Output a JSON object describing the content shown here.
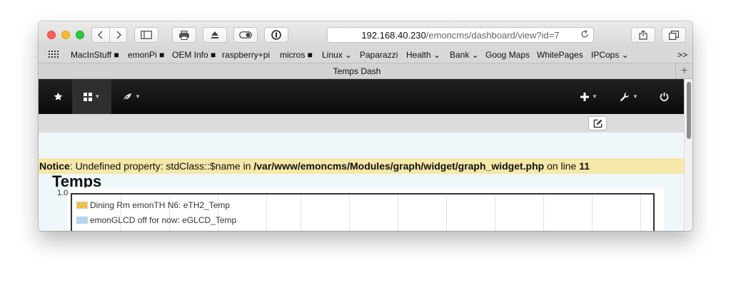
{
  "browser": {
    "url_host": "192.168.40.230",
    "url_path": "/emoncms/dashboard/view?id=7",
    "tab_title": "Temps Dash",
    "overflow_label": ">>",
    "new_tab_label": "+"
  },
  "bookmarks": [
    {
      "label": "MacInStuff ■"
    },
    {
      "label": "emonPi ■"
    },
    {
      "label": "OEM Info ■"
    },
    {
      "label": "raspberry+pi"
    },
    {
      "label": "micros ■"
    },
    {
      "label": "Linux ⌄"
    },
    {
      "label": "Paparazzi"
    },
    {
      "label": "Health ⌄"
    },
    {
      "label": "Bank ⌄"
    },
    {
      "label": "Goog Maps"
    },
    {
      "label": "WhitePages"
    },
    {
      "label": "IPCops ⌄"
    }
  ],
  "notice": {
    "prefix": "Notice",
    "message": ": Undefined property: stdClass::$name in ",
    "file": "/var/www/emoncms/Modules/graph/widget/graph_widget.php",
    "line_text": " on line ",
    "line_number": "11"
  },
  "widget": {
    "title": "Temps",
    "ytick_top": "1.0",
    "legend": [
      {
        "label": "Dining Rm emonTH N6: eTH2_Temp",
        "color": "#edc240"
      },
      {
        "label": "emonGLCD off for now: eGLCD_Temp",
        "color": "#afd8f8"
      }
    ]
  },
  "colors": {
    "nav_bg": "#111111",
    "notice_bg": "#f5e8a9",
    "content_bg": "#eff7fb"
  }
}
